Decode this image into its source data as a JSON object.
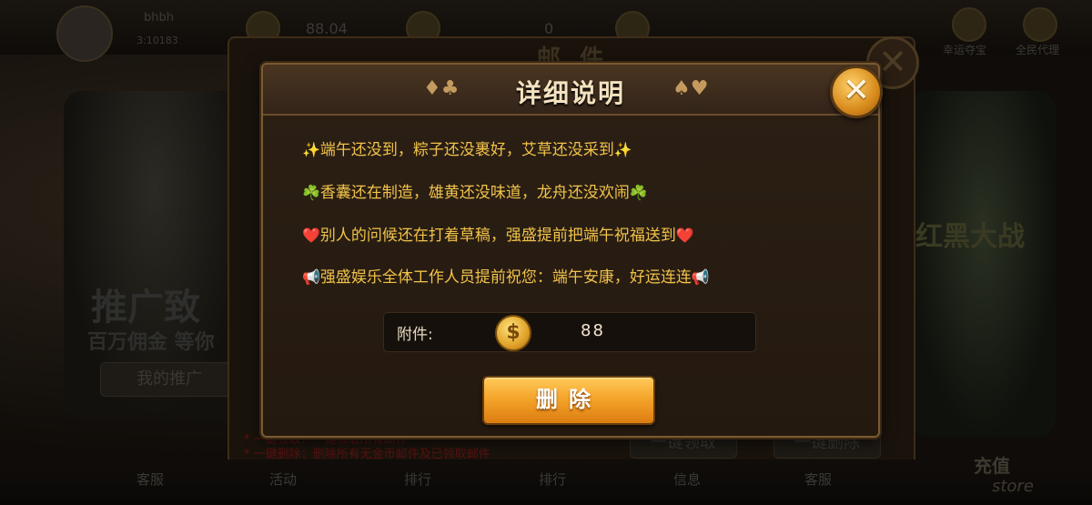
{
  "background": {
    "player_name": "bhbh",
    "player_id": "3:10183",
    "coins": "88.04",
    "count": "0",
    "top_right_items": [
      "幸运夺宝",
      "全民代理"
    ],
    "promo_title": "推广致",
    "promo_subtitle": "百万佣金 等你",
    "promo_button": "我的推广",
    "right_banner": "红黑大战",
    "bottom_nav": [
      "客服",
      "活动",
      "排行",
      "排行",
      "信息",
      "客服"
    ],
    "recharge": "充值",
    "store": "store",
    "mail_title": "邮 件",
    "receive_all": "一键领取",
    "delete_all": "一键删除",
    "note_1": "* 一键领取：一键领取所有邮件",
    "note_2": "* 一键删除：删除所有无金币邮件及已领取邮件"
  },
  "dialog": {
    "title": "详细说明",
    "close_label": "✕",
    "suits_left": "♦♣",
    "suits_right": "♠♥",
    "lines": [
      {
        "prefix": "✨",
        "text": "端午还没到，粽子还没裹好，艾草还没采到",
        "suffix": "✨"
      },
      {
        "prefix": "☘️",
        "text": "香囊还在制造，雄黄还没味道，龙舟还没欢闹",
        "suffix": "☘️"
      },
      {
        "prefix": "❤️",
        "text": "别人的问候还在打着草稿，强盛提前把端午祝福送到",
        "suffix": "❤️"
      },
      {
        "prefix": "📢",
        "text": "强盛娱乐全体工作人员提前祝您：端午安康，好运连连",
        "suffix": "📢"
      }
    ],
    "attachment_label": "附件:",
    "coin_symbol": "$",
    "attachment_amount": "88",
    "delete_button": "删除"
  }
}
